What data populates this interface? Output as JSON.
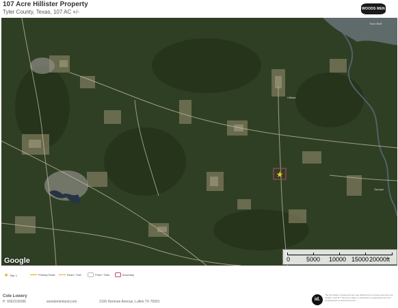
{
  "header": {
    "title": "107 Acre Hillister Property",
    "subtitle": "Tyler County, Texas, 107 AC +/-",
    "brand_logo": "WOODS MEN REALTY"
  },
  "map": {
    "attribution": "Google",
    "place_labels": {
      "hillister": "Hillister",
      "town_bluff": "Town Bluff",
      "spurger": "Spurger"
    },
    "subject_marker": "star-icon",
    "scale_bar": {
      "labels": [
        "0",
        "5000",
        "10000",
        "15000",
        "20000ft"
      ]
    },
    "colors": {
      "forest": "#2f3f24",
      "clearing": "#8c8c72",
      "water": "#2a3a4a",
      "road": "#c8bea8",
      "marker": "#f5c518"
    }
  },
  "legend": {
    "items": [
      {
        "icon": "star-icon",
        "label": "Star 1"
      },
      {
        "icon": "primary-road-icon",
        "label": "Primary Road"
      },
      {
        "icon": "road-trail-icon",
        "label": "Road / Trail"
      },
      {
        "icon": "pond-tank-icon",
        "label": "Pond / Tank"
      },
      {
        "icon": "boundary-icon",
        "label": "Boundary"
      }
    ]
  },
  "footer": {
    "agent_name": "Cole Lowery",
    "phone": "P: 9362156096",
    "website": "woodsmenland.com",
    "address": "2106 Denman Avenue, Lufkin TX 75901",
    "id_logo": "id.",
    "disclaimer": "The information contained herein was obtained from sources deemed to be reliable. Land id™ Services makes no warranties or guarantees as to the completeness or accuracy thereof."
  }
}
